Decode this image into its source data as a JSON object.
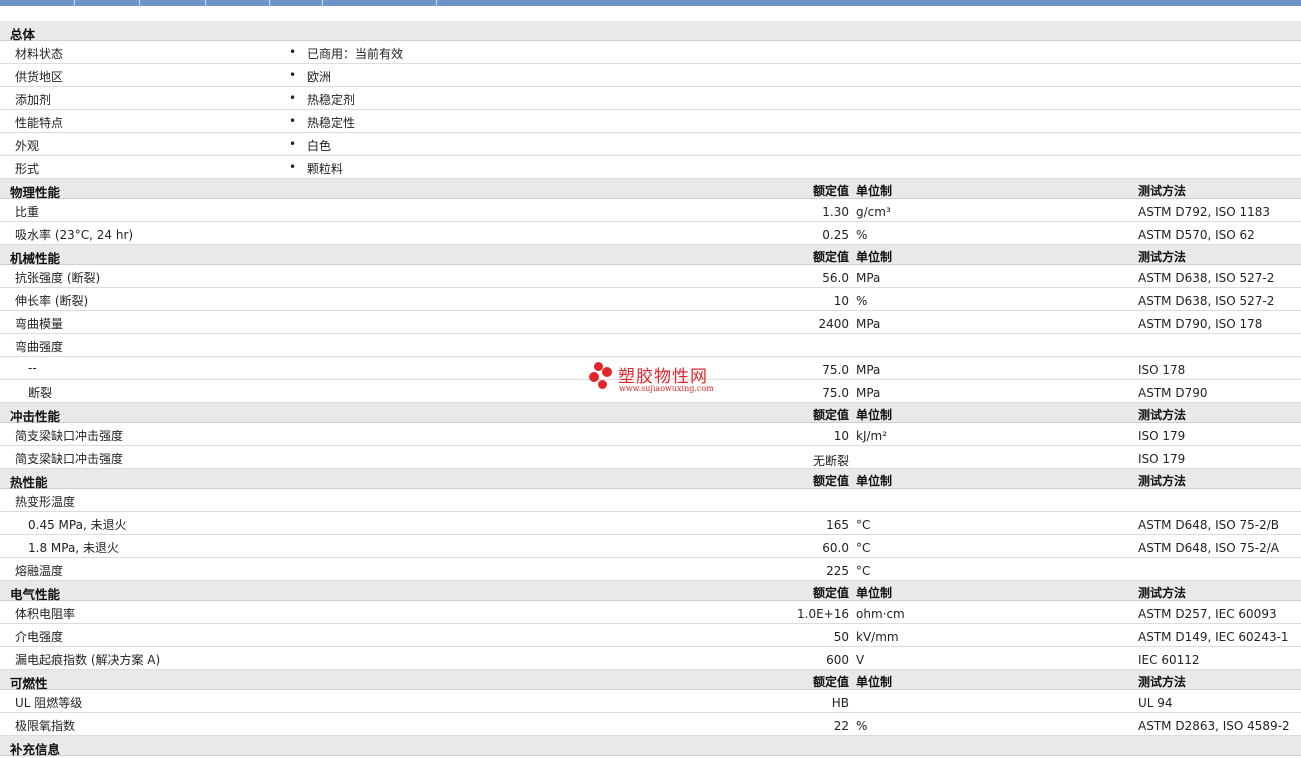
{
  "sections": [
    {
      "title": "总体",
      "kind": "general",
      "rows": [
        {
          "label": "材料状态",
          "value": "已商用：当前有效"
        },
        {
          "label": "供货地区",
          "value": "欧洲"
        },
        {
          "label": "添加剂",
          "value": "热稳定剂"
        },
        {
          "label": "性能特点",
          "value": "热稳定性"
        },
        {
          "label": "外观",
          "value": "白色"
        },
        {
          "label": "形式",
          "value": "颗粒料"
        }
      ]
    },
    {
      "title": "物理性能",
      "kind": "table",
      "rows": [
        {
          "label": "比重",
          "nominal": "1.30",
          "unit": "g/cm³",
          "test": "ASTM D792, ISO 1183"
        },
        {
          "label": "吸水率 (23°C, 24 hr)",
          "nominal": "0.25",
          "unit": "%",
          "test": "ASTM D570, ISO 62"
        }
      ]
    },
    {
      "title": "机械性能",
      "kind": "table",
      "rows": [
        {
          "label": "抗张强度 (断裂)",
          "nominal": "56.0",
          "unit": "MPa",
          "test": "ASTM D638, ISO 527-2"
        },
        {
          "label": "伸长率 (断裂)",
          "nominal": "10",
          "unit": "%",
          "test": "ASTM D638, ISO 527-2"
        },
        {
          "label": "弯曲模量",
          "nominal": "2400",
          "unit": "MPa",
          "test": "ASTM D790, ISO 178"
        },
        {
          "label": "弯曲强度",
          "nominal": "",
          "unit": "",
          "test": ""
        },
        {
          "label": "--",
          "nominal": "75.0",
          "unit": "MPa",
          "test": "ISO 178",
          "sub": true
        },
        {
          "label": "断裂",
          "nominal": "75.0",
          "unit": "MPa",
          "test": "ASTM D790",
          "sub": true
        }
      ]
    },
    {
      "title": "冲击性能",
      "kind": "table",
      "rows": [
        {
          "label": "简支梁缺口冲击强度",
          "nominal": "10",
          "unit": "kJ/m²",
          "test": "ISO 179"
        },
        {
          "label": "简支梁缺口冲击强度",
          "nominal": "无断裂",
          "unit": "",
          "test": "ISO 179"
        }
      ]
    },
    {
      "title": "热性能",
      "kind": "table",
      "rows": [
        {
          "label": "热变形温度",
          "nominal": "",
          "unit": "",
          "test": ""
        },
        {
          "label": "0.45 MPa, 未退火",
          "nominal": "165",
          "unit": "°C",
          "test": "ASTM D648, ISO 75-2/B",
          "sub": true
        },
        {
          "label": "1.8 MPa, 未退火",
          "nominal": "60.0",
          "unit": "°C",
          "test": "ASTM D648, ISO 75-2/A",
          "sub": true
        },
        {
          "label": "熔融温度",
          "nominal": "225",
          "unit": "°C",
          "test": ""
        }
      ]
    },
    {
      "title": "电气性能",
      "kind": "table",
      "rows": [
        {
          "label": "体积电阻率",
          "nominal": "1.0E+16",
          "unit": "ohm·cm",
          "test": "ASTM D257, IEC 60093"
        },
        {
          "label": "介电强度",
          "nominal": "50",
          "unit": "kV/mm",
          "test": "ASTM D149, IEC 60243-1"
        },
        {
          "label": "漏电起痕指数 (解决方案 A)",
          "nominal": "600",
          "unit": "V",
          "test": "IEC 60112"
        }
      ]
    },
    {
      "title": "可燃性",
      "kind": "table",
      "rows": [
        {
          "label": "UL 阻燃等级",
          "nominal": "HB",
          "unit": "",
          "test": "UL 94"
        },
        {
          "label": "极限氧指数",
          "nominal": "22",
          "unit": "%",
          "test": "ASTM D2863, ISO 4589-2"
        }
      ]
    },
    {
      "title": "补充信息",
      "kind": "none",
      "rows": []
    }
  ],
  "headers": {
    "nominal": "额定值",
    "unit": "单位制",
    "test": "测试方法"
  },
  "bullet": "•",
  "watermark": {
    "cn": "塑胶物性网",
    "en": "www.sujiaowuxing.com"
  },
  "colors": {
    "topbar": "#6e93c6",
    "section_bg": "#e9e9e9",
    "watermark": "#e3262a"
  }
}
